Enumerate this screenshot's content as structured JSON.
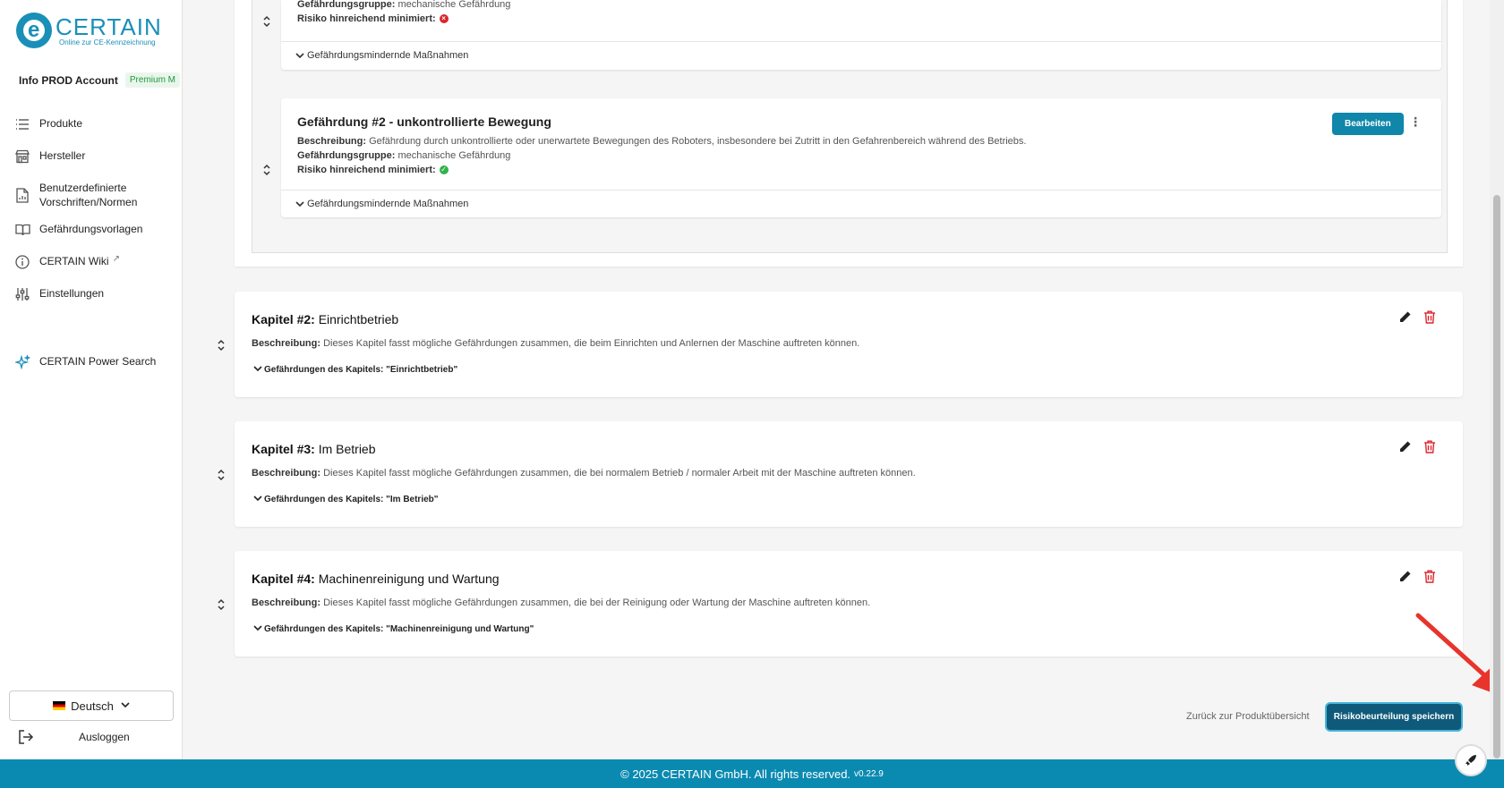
{
  "brand": {
    "name": "CERTAIN",
    "tagline": "Online zur CE-Kennzeichnung"
  },
  "account": {
    "name": "Info PROD Account",
    "plan": "Premium M"
  },
  "nav": [
    {
      "label": "Produkte",
      "icon": "list-icon"
    },
    {
      "label": "Hersteller",
      "icon": "store-icon"
    },
    {
      "label": "Benutzerdefinierte Vorschriften/Normen",
      "icon": "document-icon"
    },
    {
      "label": "Gefährdungsvorlagen",
      "icon": "book-icon"
    },
    {
      "label": "CERTAIN Wiki",
      "icon": "info-icon"
    },
    {
      "label": "Einstellungen",
      "icon": "sliders-icon"
    },
    {
      "label": "CERTAIN Power Search",
      "icon": "sparkle-icon"
    }
  ],
  "language": {
    "selected": "Deutsch"
  },
  "logout_label": "Ausloggen",
  "hazard1": {
    "group_label": "Gefährdungsgruppe:",
    "group_value": "mechanische Gefährdung",
    "risk_label": "Risiko hinreichend minimiert:",
    "measures_toggle": "Gefährdungsmindernde Maßnahmen"
  },
  "hazard2": {
    "title": "Gefährdung #2 - unkontrollierte Bewegung",
    "desc_label": "Beschreibung:",
    "desc_value": "Gefährdung durch unkontrollierte oder unerwartete Bewegungen des Roboters, insbesondere bei Zutritt in den Gefahrenbereich während des Betriebs.",
    "group_label": "Gefährdungsgruppe:",
    "group_value": "mechanische Gefährdung",
    "risk_label": "Risiko hinreichend minimiert:",
    "edit_label": "Bearbeiten",
    "measures_toggle": "Gefährdungsmindernde Maßnahmen"
  },
  "chapters": [
    {
      "label": "Kapitel #2:",
      "name": "Einrichtbetrieb",
      "desc_label": "Beschreibung:",
      "desc_value": "Dieses Kapitel fasst mögliche Gefährdungen zusammen, die beim Einrichten und Anlernen der Maschine auftreten können.",
      "toggle": "Gefährdungen des Kapitels: \"Einrichtbetrieb\""
    },
    {
      "label": "Kapitel #3:",
      "name": "Im Betrieb",
      "desc_label": "Beschreibung:",
      "desc_value": "Dieses Kapitel fasst mögliche Gefährdungen zusammen, die bei normalem Betrieb / normaler Arbeit mit der Maschine auftreten können.",
      "toggle": "Gefährdungen des Kapitels: \"Im Betrieb\""
    },
    {
      "label": "Kapitel #4:",
      "name": "Machinenreinigung und Wartung",
      "desc_label": "Beschreibung:",
      "desc_value": "Dieses Kapitel fasst mögliche Gefährdungen zusammen, die bei der Reinigung oder Wartung der Maschine auftreten können.",
      "toggle": "Gefährdungen des Kapitels: \"Machinenreinigung und Wartung\""
    }
  ],
  "actions": {
    "back_label": "Zurück zur Produktübersicht",
    "save_label": "Risikobeurteilung speichern"
  },
  "footer": {
    "text": "© 2025 CERTAIN GmbH. All rights reserved.",
    "version": "v0.22.9"
  },
  "colors": {
    "primary": "#0f86aa",
    "footer": "#0b8ab1",
    "danger": "#d9262e",
    "success": "#33b24a",
    "annotation_arrow": "#e8342b"
  }
}
